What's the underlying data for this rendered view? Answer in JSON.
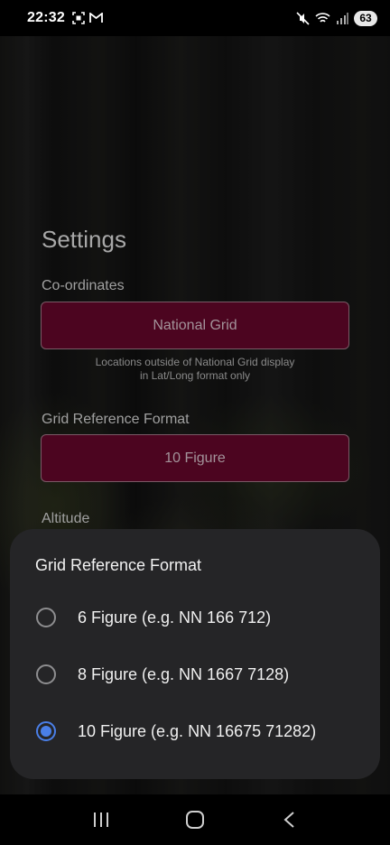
{
  "status_bar": {
    "time": "22:32",
    "left_icons": [
      "screenshot-icon",
      "gmail-icon"
    ],
    "right_icons": [
      "mute-icon",
      "wifi-icon",
      "signal-icon"
    ],
    "battery": "63"
  },
  "settings": {
    "title": "Settings",
    "coordinates": {
      "label": "Co-ordinates",
      "value": "National Grid",
      "note_line1": "Locations outside of National Grid display",
      "note_line2": "in Lat/Long format only"
    },
    "grid_reference": {
      "label": "Grid Reference Format",
      "value": "10 Figure"
    },
    "altitude": {
      "label": "Altitude"
    }
  },
  "dialog": {
    "title": "Grid Reference Format",
    "options": [
      {
        "label": "6 Figure (e.g. NN 166 712)",
        "selected": false
      },
      {
        "label": "8 Figure (e.g. NN 1667 7128)",
        "selected": false
      },
      {
        "label": "10 Figure (e.g. NN 16675 71282)",
        "selected": true
      }
    ]
  },
  "colors": {
    "select_background": "#4c0520",
    "radio_accent": "#4a7fe8",
    "dialog_background": "#252527"
  },
  "nav_bar": {
    "buttons": [
      "recents-icon",
      "home-icon",
      "back-icon"
    ]
  }
}
